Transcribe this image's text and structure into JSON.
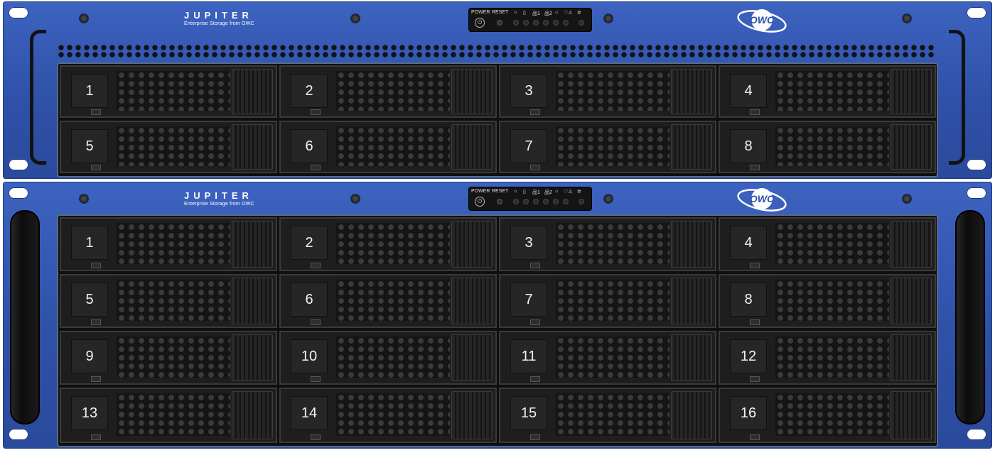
{
  "units": [
    {
      "brand_name": "JUPITER",
      "brand_tagline": "Enterprise Storage from OWC",
      "panel": {
        "power_label": "POWER",
        "reset_label": "RESET"
      },
      "logo_text": "OWC",
      "bays": [
        "1",
        "2",
        "3",
        "4",
        "5",
        "6",
        "7",
        "8"
      ]
    },
    {
      "brand_name": "JUPITER",
      "brand_tagline": "Enterprise Storage from OWC",
      "panel": {
        "power_label": "POWER",
        "reset_label": "RESET"
      },
      "logo_text": "OWC",
      "bays": [
        "1",
        "2",
        "3",
        "4",
        "5",
        "6",
        "7",
        "8",
        "9",
        "10",
        "11",
        "12",
        "13",
        "14",
        "15",
        "16"
      ]
    }
  ],
  "colors": {
    "chassis": "#2f51a8",
    "bay": "#1e1e1e",
    "led": "#2c2c2c"
  },
  "icons": [
    "power-icon",
    "sun-icon",
    "drive-icon",
    "network-1-icon",
    "network-2-icon",
    "temperature-icon",
    "warning-icon",
    "fan-icon"
  ]
}
